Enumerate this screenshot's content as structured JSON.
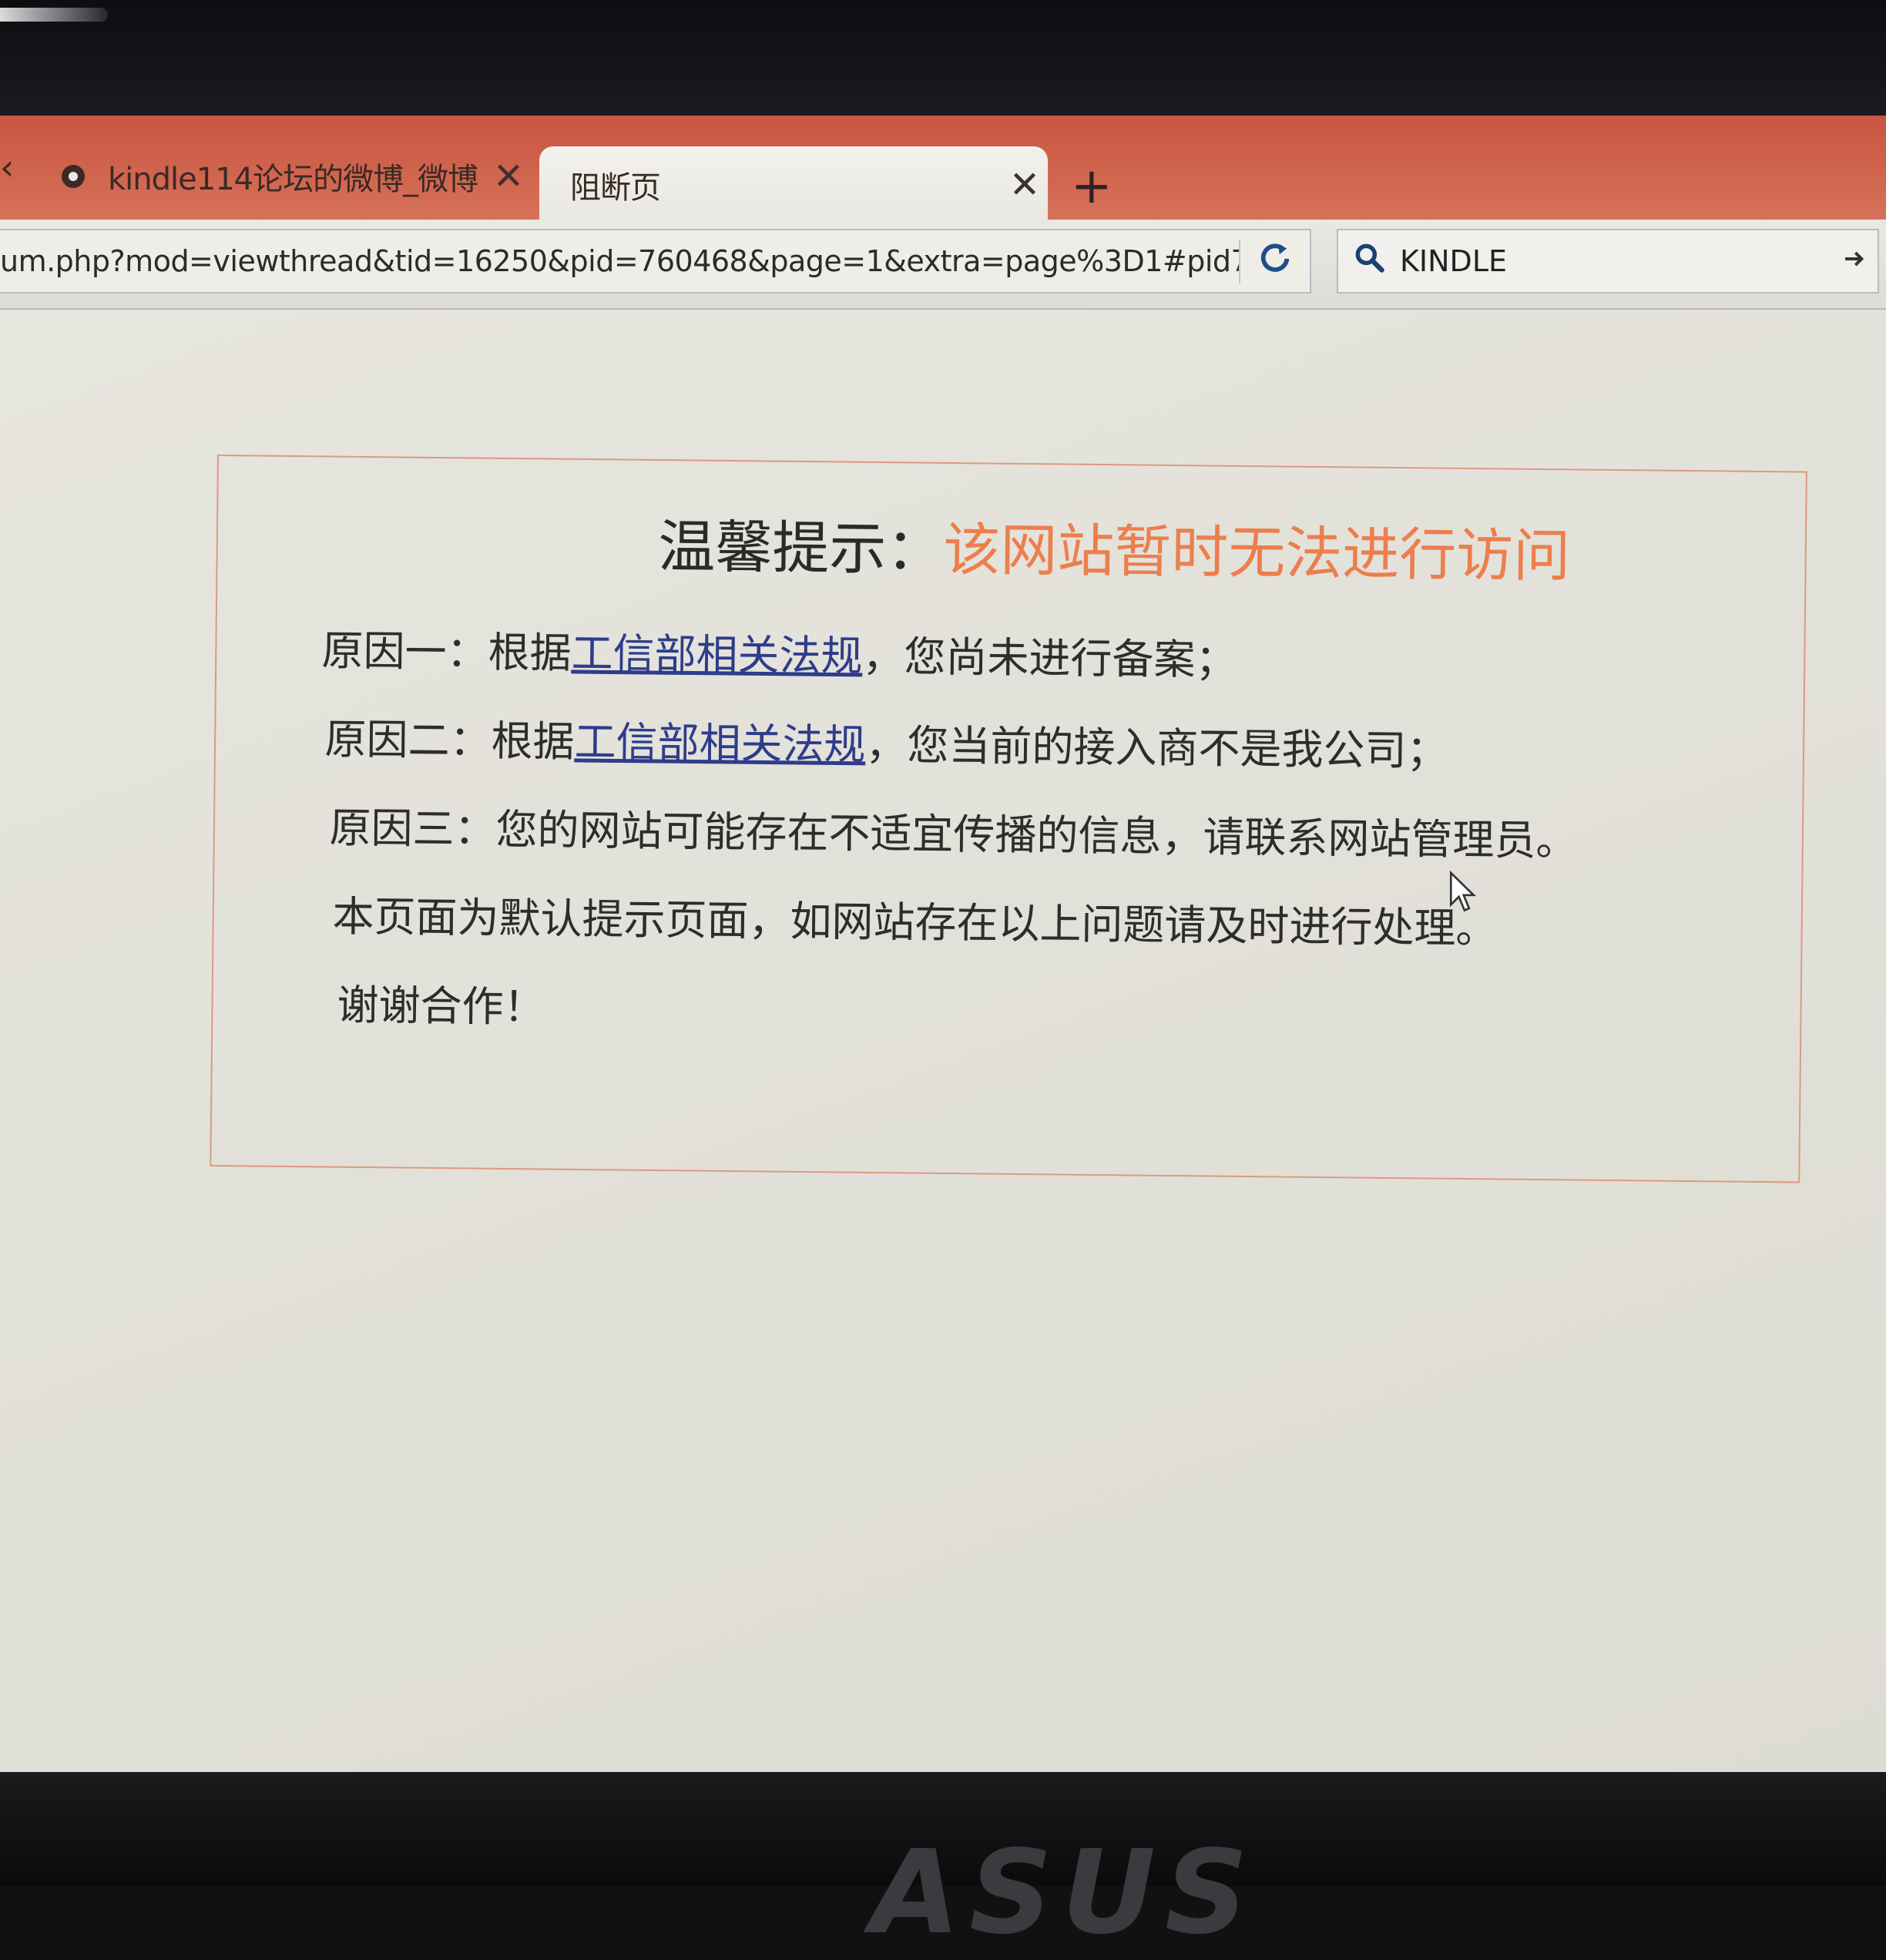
{
  "browser": {
    "tabs": [
      {
        "title": "kindle114论坛的微博_微博",
        "active": false
      },
      {
        "title": "阻断页",
        "active": true
      }
    ],
    "tab_close_glyph": "✕",
    "new_tab_glyph": "+",
    "left_arrow_glyph": "‹",
    "url": "um.php?mod=viewthread&tid=16250&pid=760468&page=1&extra=page%3D1#pid7",
    "search": {
      "value": "KINDLE"
    },
    "icons": {
      "reload": "reload-icon",
      "search": "search-icon",
      "go": "arrow-right-icon"
    }
  },
  "notice": {
    "title_label": "温馨提示：",
    "title_message": "该网站暂时无法进行访问",
    "reasons": [
      {
        "prefix": "原因一：根据",
        "link": "工信部相关法规",
        "suffix": "，您尚未进行备案；"
      },
      {
        "prefix": "原因二：根据",
        "link": "工信部相关法规",
        "suffix": "，您当前的接入商不是我公司；"
      },
      {
        "prefix": "原因三：您的网站可能存在不适宜传播的信息，请联系网站管理员。",
        "link": "",
        "suffix": ""
      }
    ],
    "footer_note": "本页面为默认提示页面，如网站存在以上问题请及时进行处理。",
    "thanks": "谢谢合作！"
  },
  "device": {
    "brand": "ASUS"
  },
  "colors": {
    "tab_strip": "#d06350",
    "title_accent": "#ec7f4d",
    "link": "#2f3c8a",
    "border": "#dc9a80"
  }
}
